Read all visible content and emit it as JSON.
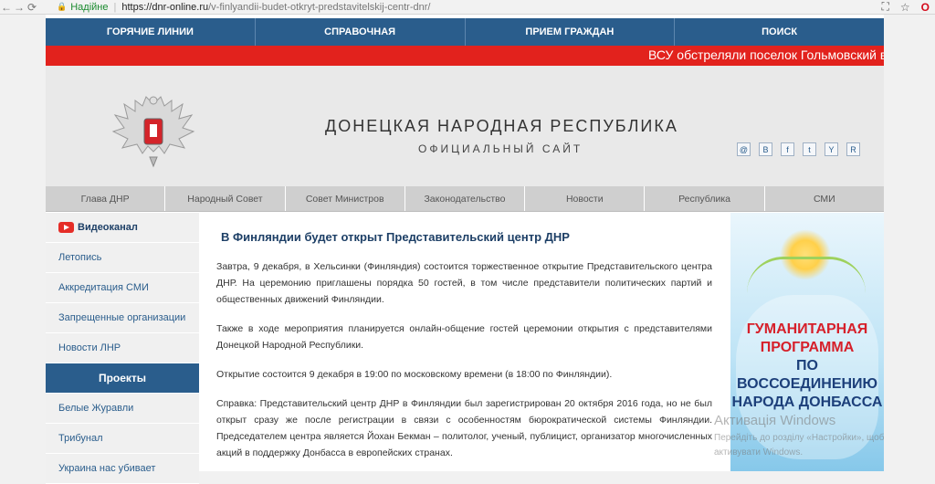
{
  "browser": {
    "secure_label": "Надійне",
    "url_domain": "https://dnr-online.ru",
    "url_path": "/v-finlyandii-budet-otkryt-predstavitelskij-centr-dnr/"
  },
  "topnav": [
    "ГОРЯЧИЕ ЛИНИИ",
    "СПРАВОЧНАЯ",
    "ПРИЕМ ГРАЖДАН",
    "ПОИСК"
  ],
  "ticker": "ВСУ обстреляли поселок Гольмовский в",
  "header": {
    "title": "ДОНЕЦКАЯ НАРОДНАЯ РЕСПУБЛИКА",
    "subtitle": "ОФИЦИАЛЬНЫЙ САЙТ",
    "social": [
      "@",
      "B",
      "f",
      "t",
      "Y",
      "R"
    ]
  },
  "mainnav": [
    "Глава ДНР",
    "Народный Совет",
    "Совет Министров",
    "Законодательство",
    "Новости",
    "Республика",
    "СМИ"
  ],
  "sidebar": {
    "video": "Видеоканал",
    "items_top": [
      "Летопись",
      "Аккредитация СМИ",
      "Запрещенные организации",
      "Новости ЛНР"
    ],
    "projects": "Проекты",
    "items_bottom": [
      "Белые Журавли",
      "Трибунал",
      "Украина нас убивает"
    ]
  },
  "article": {
    "title": "В Финляндии будет открыт Представительский центр ДНР",
    "p1": "Завтра, 9 декабря, в Хельсинки (Финляндия) состоится торжественное открытие Представительского центра ДНР. На церемонию приглашены порядка 50 гостей, в том числе представители политических партий и общественных движений Финляндии.",
    "p2": "Также в ходе мероприятия планируется онлайн-общение гостей церемонии открытия с представителями Донецкой Народной Республики.",
    "p3": "Открытие состоится 9 декабря в 19:00 по московскому времени (в 18:00 по Финляндии).",
    "p4": "Справка: Представительский центр ДНР в Финляндии был зарегистрирован 20 октября 2016 года, но не был открыт сразу же после регистрации в связи с особенностям бюрократической системы Финляндии. Председателем центра является Йохан Бекман – политолог, ученый, публицист, организатор многочисленных акций в поддержку Донбасса в европейских странах."
  },
  "banner": {
    "line1": "ГУМАНИТАРНАЯ",
    "line2": "ПРОГРАММА",
    "line3": "ПО ВОССОЕДИНЕНИЮ",
    "line4": "НАРОДА ДОНБАССА"
  },
  "watermark": {
    "title": "Активація Windows",
    "text": "Перейдіть до розділу «Настройки», щоб активувати Windows."
  }
}
